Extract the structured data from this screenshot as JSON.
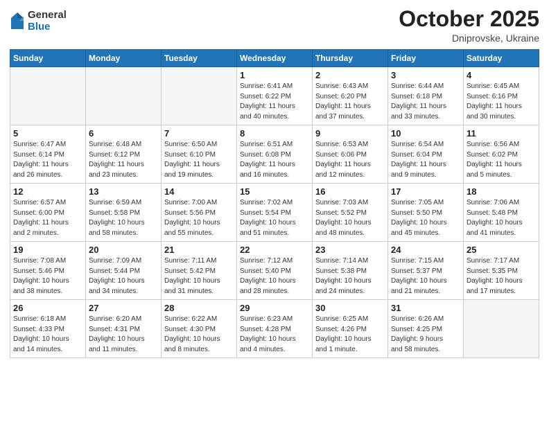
{
  "logo": {
    "general": "General",
    "blue": "Blue"
  },
  "header": {
    "month": "October 2025",
    "location": "Dniprovske, Ukraine"
  },
  "weekdays": [
    "Sunday",
    "Monday",
    "Tuesday",
    "Wednesday",
    "Thursday",
    "Friday",
    "Saturday"
  ],
  "weeks": [
    [
      {
        "day": "",
        "info": ""
      },
      {
        "day": "",
        "info": ""
      },
      {
        "day": "",
        "info": ""
      },
      {
        "day": "1",
        "info": "Sunrise: 6:41 AM\nSunset: 6:22 PM\nDaylight: 11 hours\nand 40 minutes."
      },
      {
        "day": "2",
        "info": "Sunrise: 6:43 AM\nSunset: 6:20 PM\nDaylight: 11 hours\nand 37 minutes."
      },
      {
        "day": "3",
        "info": "Sunrise: 6:44 AM\nSunset: 6:18 PM\nDaylight: 11 hours\nand 33 minutes."
      },
      {
        "day": "4",
        "info": "Sunrise: 6:45 AM\nSunset: 6:16 PM\nDaylight: 11 hours\nand 30 minutes."
      }
    ],
    [
      {
        "day": "5",
        "info": "Sunrise: 6:47 AM\nSunset: 6:14 PM\nDaylight: 11 hours\nand 26 minutes."
      },
      {
        "day": "6",
        "info": "Sunrise: 6:48 AM\nSunset: 6:12 PM\nDaylight: 11 hours\nand 23 minutes."
      },
      {
        "day": "7",
        "info": "Sunrise: 6:50 AM\nSunset: 6:10 PM\nDaylight: 11 hours\nand 19 minutes."
      },
      {
        "day": "8",
        "info": "Sunrise: 6:51 AM\nSunset: 6:08 PM\nDaylight: 11 hours\nand 16 minutes."
      },
      {
        "day": "9",
        "info": "Sunrise: 6:53 AM\nSunset: 6:06 PM\nDaylight: 11 hours\nand 12 minutes."
      },
      {
        "day": "10",
        "info": "Sunrise: 6:54 AM\nSunset: 6:04 PM\nDaylight: 11 hours\nand 9 minutes."
      },
      {
        "day": "11",
        "info": "Sunrise: 6:56 AM\nSunset: 6:02 PM\nDaylight: 11 hours\nand 5 minutes."
      }
    ],
    [
      {
        "day": "12",
        "info": "Sunrise: 6:57 AM\nSunset: 6:00 PM\nDaylight: 11 hours\nand 2 minutes."
      },
      {
        "day": "13",
        "info": "Sunrise: 6:59 AM\nSunset: 5:58 PM\nDaylight: 10 hours\nand 58 minutes."
      },
      {
        "day": "14",
        "info": "Sunrise: 7:00 AM\nSunset: 5:56 PM\nDaylight: 10 hours\nand 55 minutes."
      },
      {
        "day": "15",
        "info": "Sunrise: 7:02 AM\nSunset: 5:54 PM\nDaylight: 10 hours\nand 51 minutes."
      },
      {
        "day": "16",
        "info": "Sunrise: 7:03 AM\nSunset: 5:52 PM\nDaylight: 10 hours\nand 48 minutes."
      },
      {
        "day": "17",
        "info": "Sunrise: 7:05 AM\nSunset: 5:50 PM\nDaylight: 10 hours\nand 45 minutes."
      },
      {
        "day": "18",
        "info": "Sunrise: 7:06 AM\nSunset: 5:48 PM\nDaylight: 10 hours\nand 41 minutes."
      }
    ],
    [
      {
        "day": "19",
        "info": "Sunrise: 7:08 AM\nSunset: 5:46 PM\nDaylight: 10 hours\nand 38 minutes."
      },
      {
        "day": "20",
        "info": "Sunrise: 7:09 AM\nSunset: 5:44 PM\nDaylight: 10 hours\nand 34 minutes."
      },
      {
        "day": "21",
        "info": "Sunrise: 7:11 AM\nSunset: 5:42 PM\nDaylight: 10 hours\nand 31 minutes."
      },
      {
        "day": "22",
        "info": "Sunrise: 7:12 AM\nSunset: 5:40 PM\nDaylight: 10 hours\nand 28 minutes."
      },
      {
        "day": "23",
        "info": "Sunrise: 7:14 AM\nSunset: 5:38 PM\nDaylight: 10 hours\nand 24 minutes."
      },
      {
        "day": "24",
        "info": "Sunrise: 7:15 AM\nSunset: 5:37 PM\nDaylight: 10 hours\nand 21 minutes."
      },
      {
        "day": "25",
        "info": "Sunrise: 7:17 AM\nSunset: 5:35 PM\nDaylight: 10 hours\nand 17 minutes."
      }
    ],
    [
      {
        "day": "26",
        "info": "Sunrise: 6:18 AM\nSunset: 4:33 PM\nDaylight: 10 hours\nand 14 minutes."
      },
      {
        "day": "27",
        "info": "Sunrise: 6:20 AM\nSunset: 4:31 PM\nDaylight: 10 hours\nand 11 minutes."
      },
      {
        "day": "28",
        "info": "Sunrise: 6:22 AM\nSunset: 4:30 PM\nDaylight: 10 hours\nand 8 minutes."
      },
      {
        "day": "29",
        "info": "Sunrise: 6:23 AM\nSunset: 4:28 PM\nDaylight: 10 hours\nand 4 minutes."
      },
      {
        "day": "30",
        "info": "Sunrise: 6:25 AM\nSunset: 4:26 PM\nDaylight: 10 hours\nand 1 minute."
      },
      {
        "day": "31",
        "info": "Sunrise: 6:26 AM\nSunset: 4:25 PM\nDaylight: 9 hours\nand 58 minutes."
      },
      {
        "day": "",
        "info": ""
      }
    ]
  ]
}
